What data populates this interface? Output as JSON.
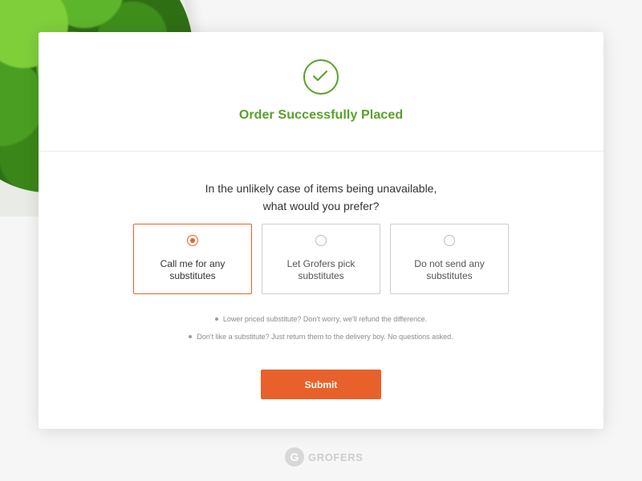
{
  "header": {
    "title": "Order Successfully Placed"
  },
  "question": {
    "line1": "In the unlikely case of items being unavailable,",
    "line2": "what would you prefer?"
  },
  "options": [
    {
      "label": "Call me for any substitutes",
      "selected": true
    },
    {
      "label": "Let Grofers pick substitutes",
      "selected": false
    },
    {
      "label": "Do not send any substitutes",
      "selected": false
    }
  ],
  "notes": [
    "Lower priced substitute? Don't worry, we'll refund the difference.",
    "Don't like a substitute? Just return them to the delivery boy. No questions asked."
  ],
  "submit_label": "Submit",
  "brand": {
    "logo_letter": "G",
    "name": "GROFERS"
  },
  "colors": {
    "success": "#58a12a",
    "accent": "#e8612b"
  },
  "icons": {
    "success": "checkmark-circle-icon",
    "decor": "cactus-plant"
  }
}
